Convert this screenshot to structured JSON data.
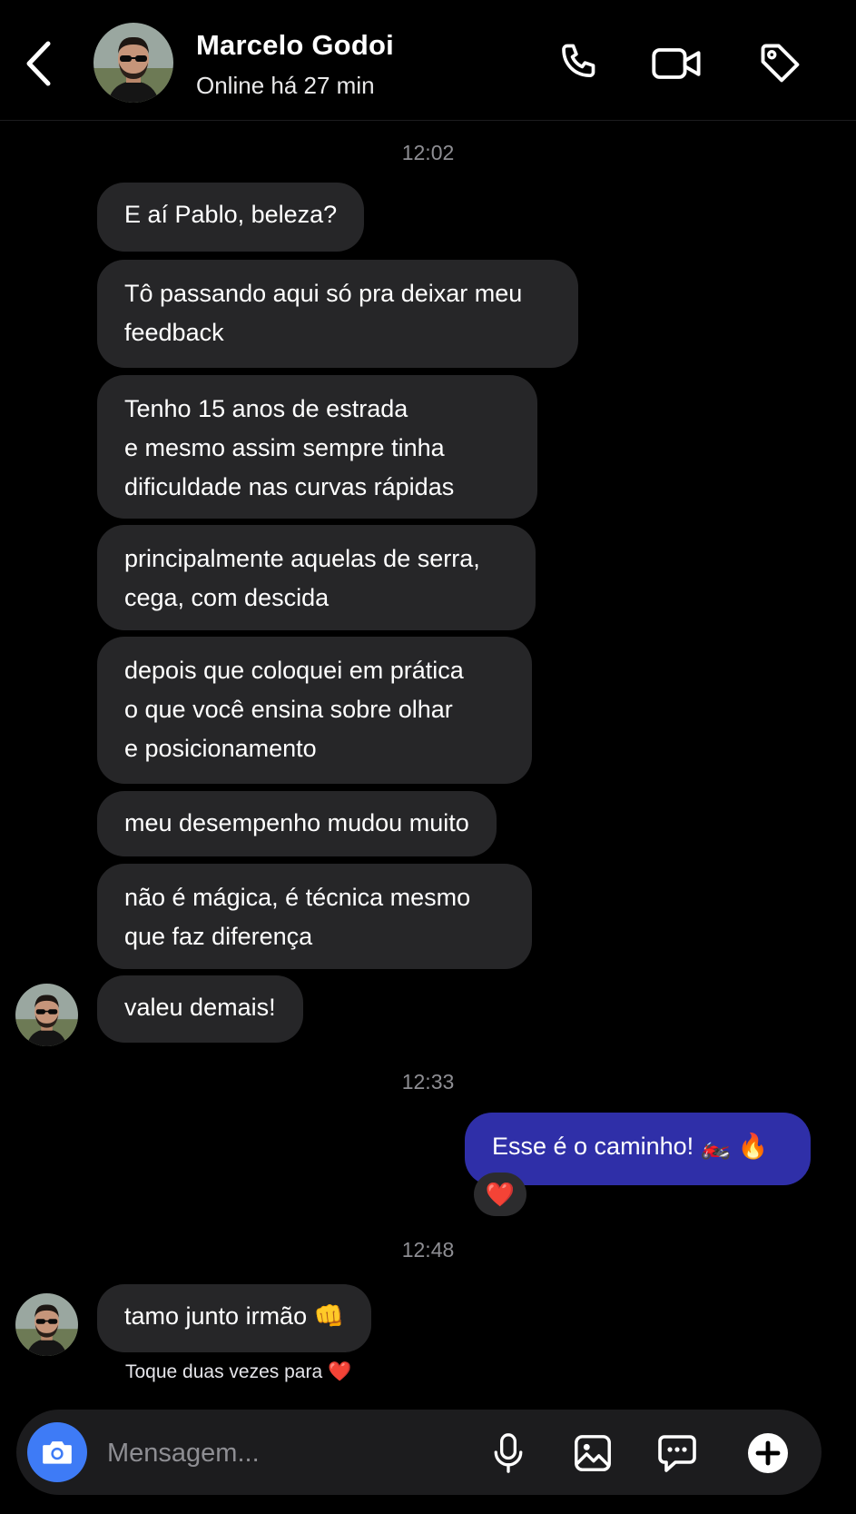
{
  "header": {
    "name": "Marcelo Godoi",
    "status": "Online há 27 min"
  },
  "messages": {
    "t1": "12:02",
    "m1": "E aí Pablo, beleza?",
    "m2": "Tô passando aqui só pra deixar meu\nfeedback",
    "m3": "Tenho 15 anos de estrada\ne mesmo assim sempre tinha\ndificuldade nas curvas rápidas",
    "m4": "principalmente aquelas de serra,\ncega, com descida",
    "m5": "depois que coloquei em prática\no que você ensina sobre olhar\ne posicionamento",
    "m6": "meu desempenho mudou muito",
    "m7": "não é mágica, é técnica mesmo\nque faz diferença",
    "m8": "valeu demais!",
    "t2": "12:33",
    "m9": "Esse é o caminho! 🏍️ 🔥",
    "reaction": "❤️",
    "t3": "12:48",
    "m10": "tamo junto irmão 👊",
    "hint": "Toque duas vezes para ❤️"
  },
  "composer": {
    "placeholder": "Mensagem..."
  },
  "colors": {
    "background": "#000000",
    "incoming_bubble": "#262628",
    "outgoing_bubble": "#2f2fa8",
    "camera_button": "#3e7bf6"
  }
}
